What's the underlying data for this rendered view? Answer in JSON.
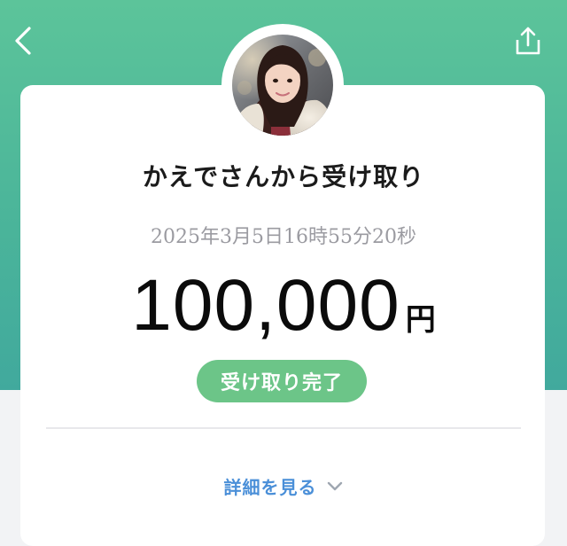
{
  "header": {
    "back_icon": "chevron-left-icon",
    "share_icon": "share-icon"
  },
  "transaction": {
    "title": "かえでさんから受け取り",
    "timestamp": "2025年3月5日16時55分20秒",
    "amount": "100,000",
    "currency": "円",
    "status": "受け取り完了"
  },
  "details": {
    "label": "詳細を見る",
    "icon": "chevron-down-icon"
  },
  "colors": {
    "header_gradient_top": "#5cc49a",
    "header_gradient_bottom": "#41a99d",
    "status_badge": "#6cc588",
    "link": "#4a8fd8"
  }
}
